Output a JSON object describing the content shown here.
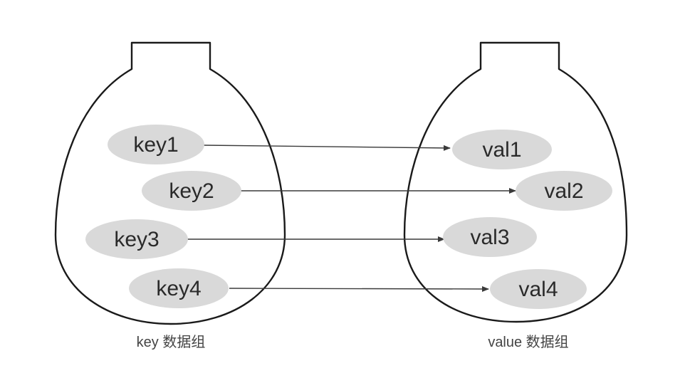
{
  "left_group": {
    "caption": "key 数据组",
    "items": [
      "key1",
      "key2",
      "key3",
      "key4"
    ]
  },
  "right_group": {
    "caption": "value 数据组",
    "items": [
      "val1",
      "val2",
      "val3",
      "val4"
    ]
  }
}
